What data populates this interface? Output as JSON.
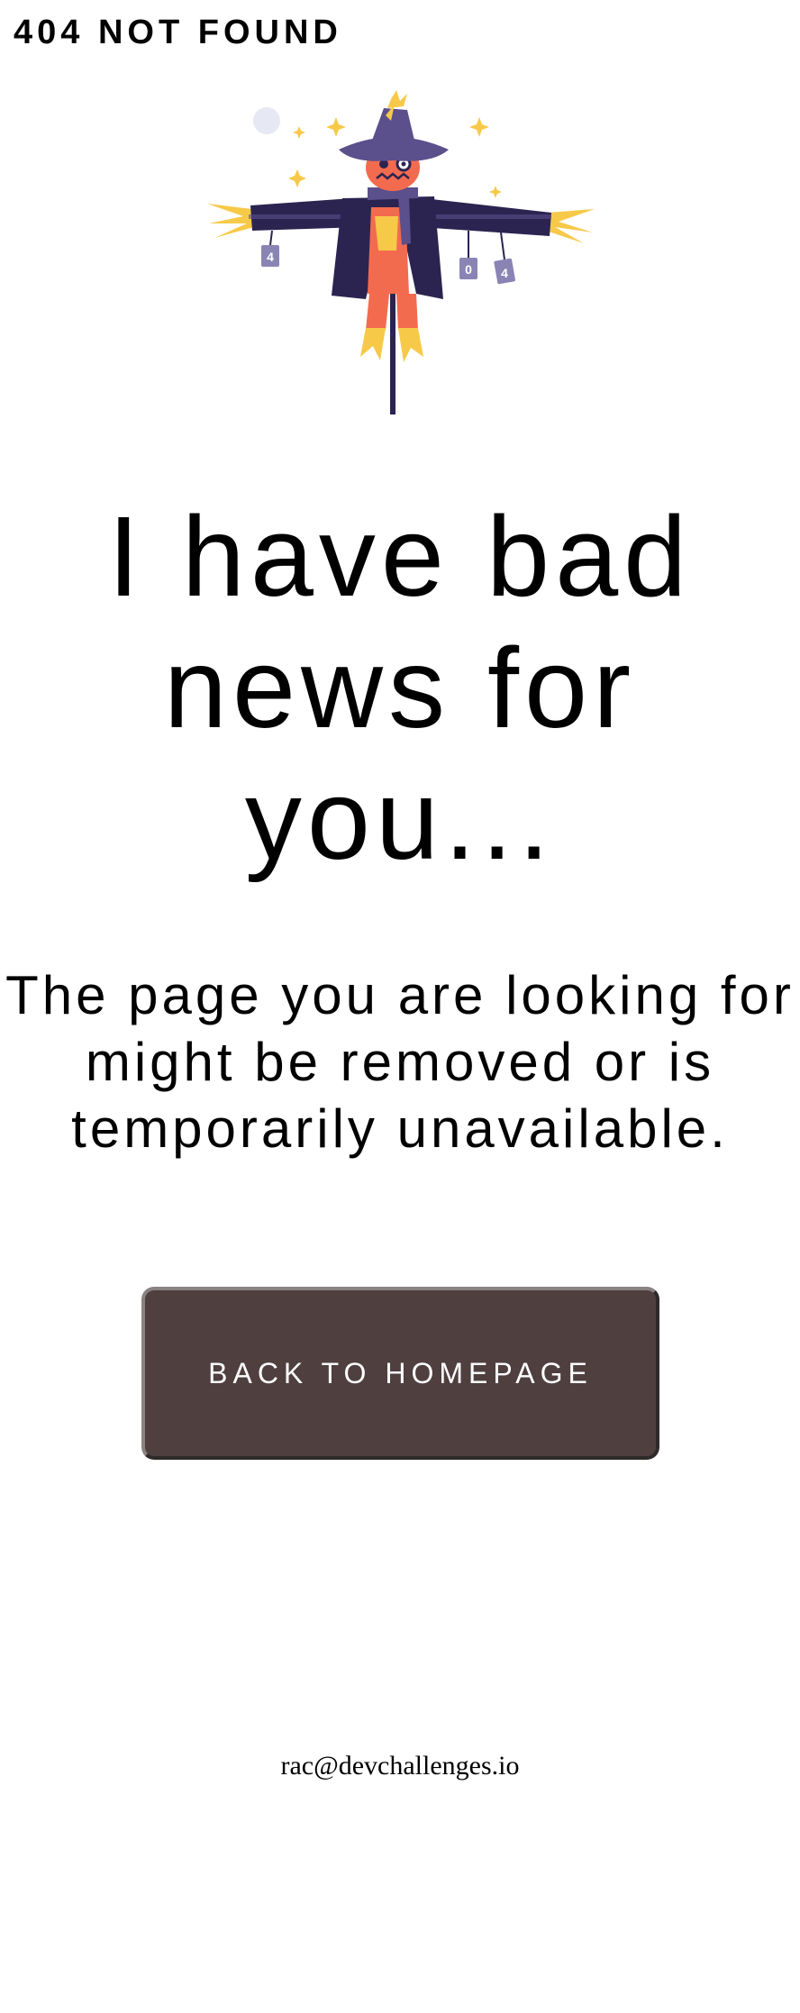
{
  "header": {
    "title": "404 NOT FOUND"
  },
  "illustration": {
    "name": "scarecrow",
    "tag_left": "4",
    "tag_middle": "0",
    "tag_right": "4"
  },
  "main": {
    "headline": "I have bad news for you...",
    "message": "The page you are looking for might be removed or is temporarily unavailable.",
    "button_label": "BACK TO HOMEPAGE"
  },
  "footer": {
    "email": "rac@devchallenges.io"
  },
  "colors": {
    "button_bg": "#4f3f3f",
    "button_text": "#ffffff",
    "hat": "#5b4f8c",
    "coat": "#2b2450",
    "face": "#f36b4f",
    "straw": "#f7c948"
  }
}
